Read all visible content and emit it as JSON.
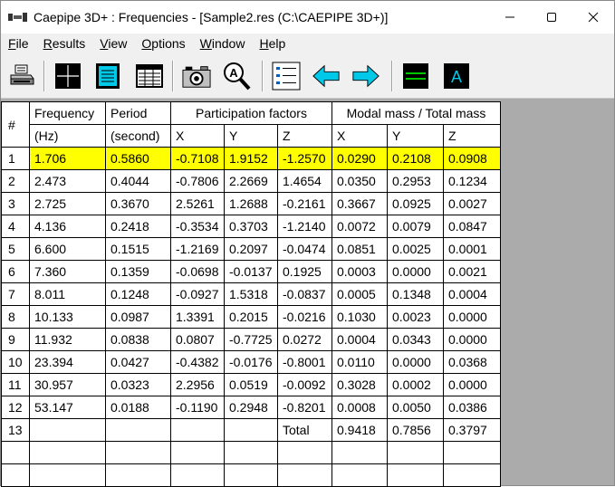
{
  "window": {
    "title": "Caepipe 3D+ : Frequencies -  [Sample2.res (C:\\CAEPIPE 3D+)]",
    "minimize": "—",
    "maximize": "☐",
    "close": "✕"
  },
  "menu": [
    {
      "label": "File",
      "u": "F",
      "rest": "ile"
    },
    {
      "label": "Results",
      "u": "R",
      "rest": "esults"
    },
    {
      "label": "View",
      "u": "V",
      "rest": "iew"
    },
    {
      "label": "Options",
      "u": "O",
      "rest": "ptions"
    },
    {
      "label": "Window",
      "u": "W",
      "rest": "indow"
    },
    {
      "label": "Help",
      "u": "H",
      "rest": "elp"
    }
  ],
  "toolbar": {
    "icons": [
      "printer-icon",
      "crosshair-icon",
      "notepad-icon",
      "list-view-icon",
      "camera-icon",
      "zoom-a-icon",
      "bulleted-list-icon",
      "arrow-left-icon",
      "arrow-right-icon",
      "lines-icon",
      "text-a-icon"
    ],
    "text_a_label": "A",
    "zoom_label": "A"
  },
  "colors": {
    "highlight": "#ffff00",
    "arrow": "#00c8e8",
    "icon_dark": "#000000",
    "icon_green": "#00c800"
  },
  "table": {
    "header": {
      "num": "#",
      "frequency": "Frequency",
      "frequency_unit": "(Hz)",
      "period": "Period",
      "period_unit": "(second)",
      "participation": "Participation factors",
      "modal_mass": "Modal mass / Total mass",
      "px": "X",
      "py": "Y",
      "pz": "Z",
      "mx": "X",
      "my": "Y",
      "mz": "Z"
    },
    "rows": [
      {
        "n": "1",
        "freq": "1.706",
        "period": "0.5860",
        "px": "-0.7108",
        "py": "1.9152",
        "pz": "-1.2570",
        "mx": "0.0290",
        "my": "0.2108",
        "mz": "0.0908"
      },
      {
        "n": "2",
        "freq": "2.473",
        "period": "0.4044",
        "px": "-0.7806",
        "py": "2.2669",
        "pz": "1.4654",
        "mx": "0.0350",
        "my": "0.2953",
        "mz": "0.1234"
      },
      {
        "n": "3",
        "freq": "2.725",
        "period": "0.3670",
        "px": "2.5261",
        "py": "1.2688",
        "pz": "-0.2161",
        "mx": "0.3667",
        "my": "0.0925",
        "mz": "0.0027"
      },
      {
        "n": "4",
        "freq": "4.136",
        "period": "0.2418",
        "px": "-0.3534",
        "py": "0.3703",
        "pz": "-1.2140",
        "mx": "0.0072",
        "my": "0.0079",
        "mz": "0.0847"
      },
      {
        "n": "5",
        "freq": "6.600",
        "period": "0.1515",
        "px": "-1.2169",
        "py": "0.2097",
        "pz": "-0.0474",
        "mx": "0.0851",
        "my": "0.0025",
        "mz": "0.0001"
      },
      {
        "n": "6",
        "freq": "7.360",
        "period": "0.1359",
        "px": "-0.0698",
        "py": "-0.0137",
        "pz": "0.1925",
        "mx": "0.0003",
        "my": "0.0000",
        "mz": "0.0021"
      },
      {
        "n": "7",
        "freq": "8.011",
        "period": "0.1248",
        "px": "-0.0927",
        "py": "1.5318",
        "pz": "-0.0837",
        "mx": "0.0005",
        "my": "0.1348",
        "mz": "0.0004"
      },
      {
        "n": "8",
        "freq": "10.133",
        "period": "0.0987",
        "px": "1.3391",
        "py": "0.2015",
        "pz": "-0.0216",
        "mx": "0.1030",
        "my": "0.0023",
        "mz": "0.0000"
      },
      {
        "n": "9",
        "freq": "11.932",
        "period": "0.0838",
        "px": "0.0807",
        "py": "-0.7725",
        "pz": "0.0272",
        "mx": "0.0004",
        "my": "0.0343",
        "mz": "0.0000"
      },
      {
        "n": "10",
        "freq": "23.394",
        "period": "0.0427",
        "px": "-0.4382",
        "py": "-0.0176",
        "pz": "-0.8001",
        "mx": "0.0110",
        "my": "0.0000",
        "mz": "0.0368"
      },
      {
        "n": "11",
        "freq": "30.957",
        "period": "0.0323",
        "px": "2.2956",
        "py": "0.0519",
        "pz": "-0.0092",
        "mx": "0.3028",
        "my": "0.0002",
        "mz": "0.0000"
      },
      {
        "n": "12",
        "freq": "53.147",
        "period": "0.0188",
        "px": "-0.1190",
        "py": "0.2948",
        "pz": "-0.8201",
        "mx": "0.0008",
        "my": "0.0050",
        "mz": "0.0386"
      },
      {
        "n": "13",
        "freq": "",
        "period": "",
        "px": "",
        "py": "",
        "pz": "Total",
        "mx": "0.9418",
        "my": "0.7856",
        "mz": "0.3797"
      },
      {
        "n": "",
        "freq": "",
        "period": "",
        "px": "",
        "py": "",
        "pz": "",
        "mx": "",
        "my": "",
        "mz": ""
      },
      {
        "n": "",
        "freq": "",
        "period": "",
        "px": "",
        "py": "",
        "pz": "",
        "mx": "",
        "my": "",
        "mz": ""
      }
    ],
    "highlighted_row": 0
  }
}
